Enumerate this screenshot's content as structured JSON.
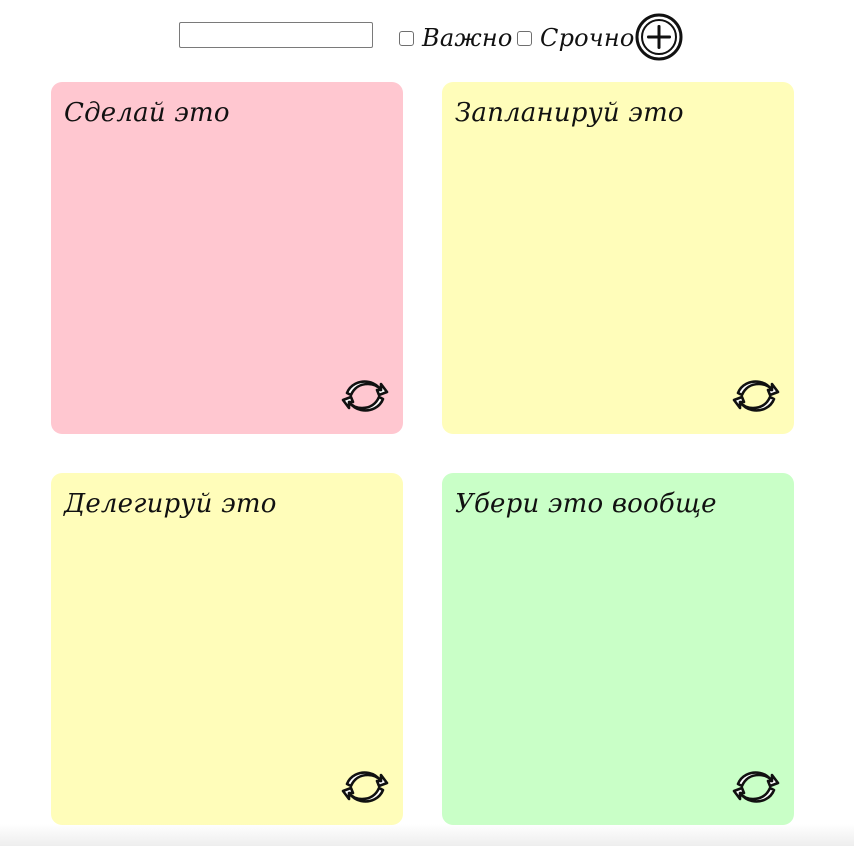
{
  "toolbar": {
    "input_value": "",
    "important_label": "Важно",
    "urgent_label": "Срочно"
  },
  "icons": {
    "add": "plus-circle-icon",
    "refresh": "refresh-icon"
  },
  "quadrants": [
    {
      "title": "Сделай это",
      "color": "#FFC7D0"
    },
    {
      "title": "Запланируй это",
      "color": "#FFFDBA"
    },
    {
      "title": "Делегируй это",
      "color": "#FFFDBA"
    },
    {
      "title": "Убери это вообще",
      "color": "#C9FFC7"
    }
  ]
}
